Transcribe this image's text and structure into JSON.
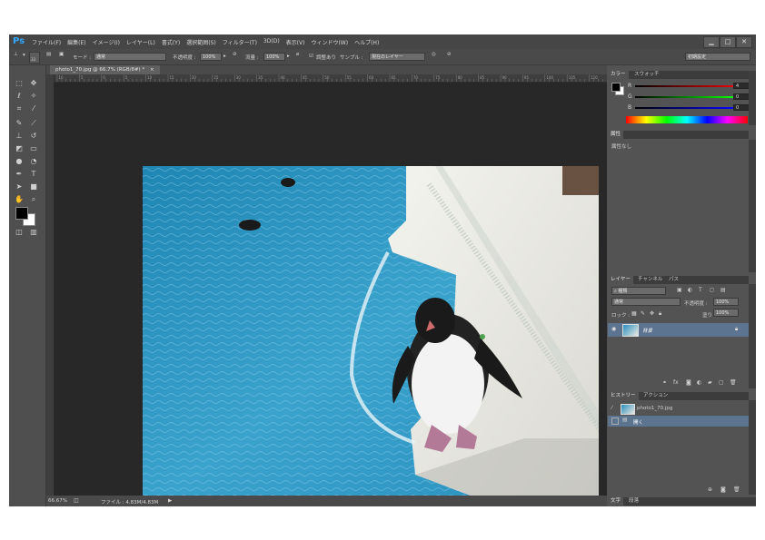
{
  "app": {
    "logo": "Ps"
  },
  "menu": [
    "ファイル(F)",
    "編集(E)",
    "イメージ(I)",
    "レイヤー(L)",
    "書式(Y)",
    "選択範囲(S)",
    "フィルター(T)",
    "3D(D)",
    "表示(V)",
    "ウィンドウ(W)",
    "ヘルプ(H)"
  ],
  "window_buttons": {
    "minimize": "▁",
    "maximize": "□",
    "close": "✕"
  },
  "options": {
    "mode_label": "モード :",
    "mode_value": "通常",
    "opacity_label": "不透明度 :",
    "opacity_value": "100%",
    "flow_label": "流量 :",
    "flow_value": "100%",
    "aligned_label": "調整あり",
    "sample_label": "サンプル :",
    "sample_value": "現在のレイヤー",
    "workspace_value": "初期設定",
    "brush_size": "33"
  },
  "document": {
    "tab_label": "photo1_70.jpg @ 66.7% (RGB/8#) *",
    "zoom": "66.67%",
    "file_info": "ファイル : 4.83M/4.83M"
  },
  "ruler_ticks": [
    "10",
    "5",
    "0",
    "5",
    "10",
    "15",
    "20",
    "25",
    "30",
    "35",
    "40",
    "45",
    "50",
    "55",
    "60",
    "65",
    "70",
    "75",
    "80",
    "85",
    "90",
    "95",
    "100",
    "105",
    "110",
    "115"
  ],
  "color_panel": {
    "tabs": [
      "カラー",
      "スウォッチ"
    ],
    "channels": [
      {
        "label": "R",
        "value": "4"
      },
      {
        "label": "G",
        "value": "0"
      },
      {
        "label": "B",
        "value": "0"
      }
    ]
  },
  "properties_panel": {
    "tab": "属性",
    "empty_text": "属性なし"
  },
  "layers_panel": {
    "tabs": [
      "レイヤー",
      "チャンネル",
      "パス"
    ],
    "filter_kind": "種類",
    "blend_mode": "通常",
    "opacity_label": "不透明度 :",
    "opacity_value": "100%",
    "lock_label": "ロック :",
    "fill_label": "塗り :",
    "fill_value": "100%",
    "layers": [
      {
        "name": "背景"
      }
    ]
  },
  "history_panel": {
    "tabs": [
      "ヒストリー",
      "アクション"
    ],
    "snapshot": "photo1_70.jpg",
    "items": [
      "開く"
    ]
  },
  "bottom_tabs": [
    "文字",
    "段落"
  ],
  "colors": {
    "app_bg": "#535353",
    "canvas_bg": "#282828",
    "selected_layer": "#5d7490",
    "accent": "#31a8ff"
  }
}
